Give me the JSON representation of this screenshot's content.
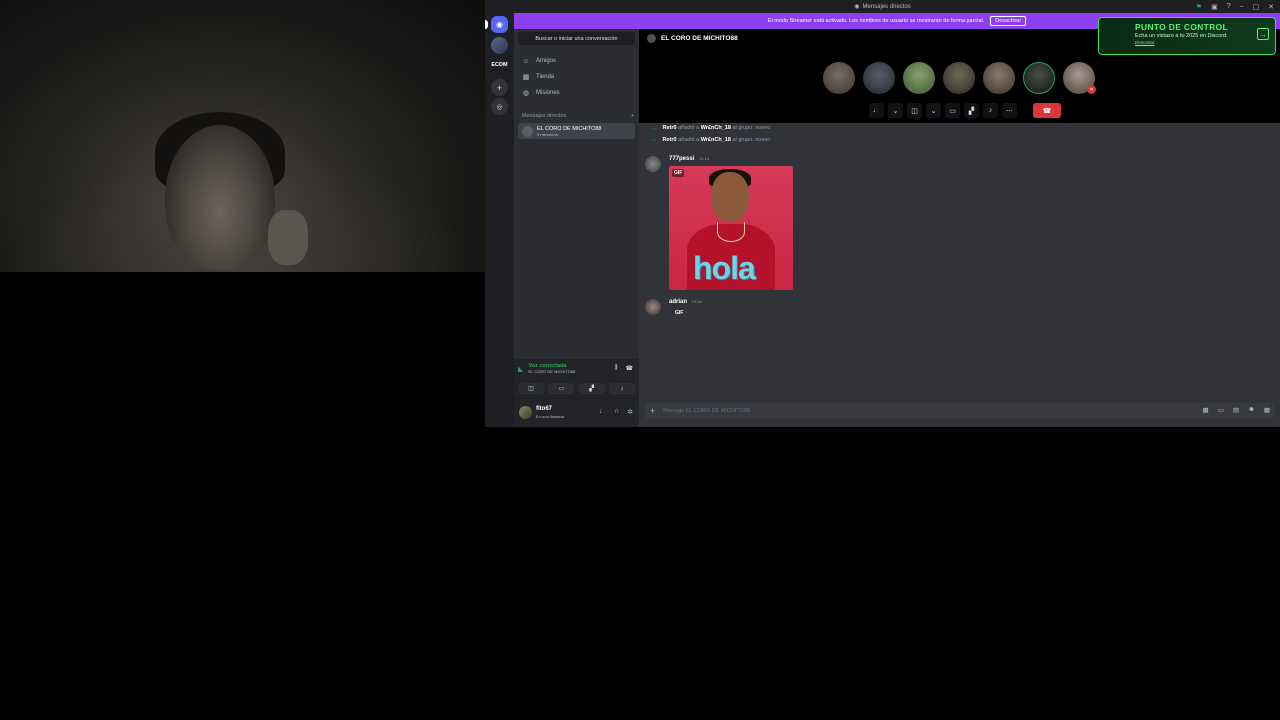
{
  "window": {
    "title": "Mensajes directos"
  },
  "streamer_bar": {
    "text": "El modo Streamer está activado. Los nombres de usuario se mostrarán de forma parcial.",
    "button": "Desactivar"
  },
  "promo": {
    "title": "PUNTO DE CONTROL",
    "text": "Echa un vistazo a tu 2025 en Discord.",
    "link": "Descartar"
  },
  "guild_bar": {
    "label": "ECDM"
  },
  "dm_panel": {
    "search_label": "Buscar o iniciar una conversación",
    "nav": [
      {
        "label": "Amigos",
        "icon": "friends-icon"
      },
      {
        "label": "Tienda",
        "icon": "shop-icon"
      },
      {
        "label": "Misiones",
        "icon": "quests-icon"
      }
    ],
    "section_label": "Mensajes directos",
    "dm_item": {
      "name": "EL CORO DE MICHITO88",
      "members": "9 miembros"
    }
  },
  "voice": {
    "status": "Voz conectada",
    "channel": "EL CORO DE MICHITO88"
  },
  "user": {
    "name": "fito67",
    "status": "En una llamada"
  },
  "chat": {
    "header": "EL CORO DE MICHITO88",
    "participants_count_shown": 7,
    "system_messages": [
      {
        "actor": "Retr0",
        "action": "añadió a",
        "target": "Wr£nCh_18",
        "suffix": "al grupo. ",
        "time": "nuevo"
      },
      {
        "actor": "Retr0",
        "action": "añadió a",
        "target": "Wr£nCh_18",
        "suffix": "al grupo. ",
        "time": "nuevo"
      }
    ],
    "messages": [
      {
        "author": "777pessi",
        "time": "13:14",
        "gif_tag": "GIF",
        "gif_text": "hola"
      },
      {
        "author": "adrian",
        "time": "13:18",
        "content": "GIF"
      }
    ],
    "composer_placeholder": "Mensaje EL CORO DE MICHITO88"
  },
  "colors": {
    "brand": "#5865f2",
    "streamer": "#8d3ff0",
    "online": "#23a55a",
    "danger": "#da373c",
    "promo_accent": "#54f27c"
  }
}
